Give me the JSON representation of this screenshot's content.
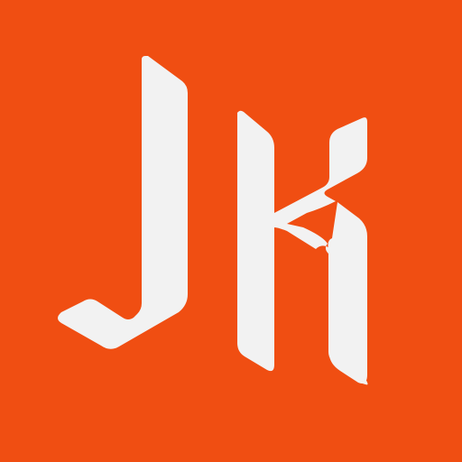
{
  "logo": {
    "text": "JK",
    "background_color": "#F04E12",
    "foreground_color": "#F2F2F2"
  }
}
